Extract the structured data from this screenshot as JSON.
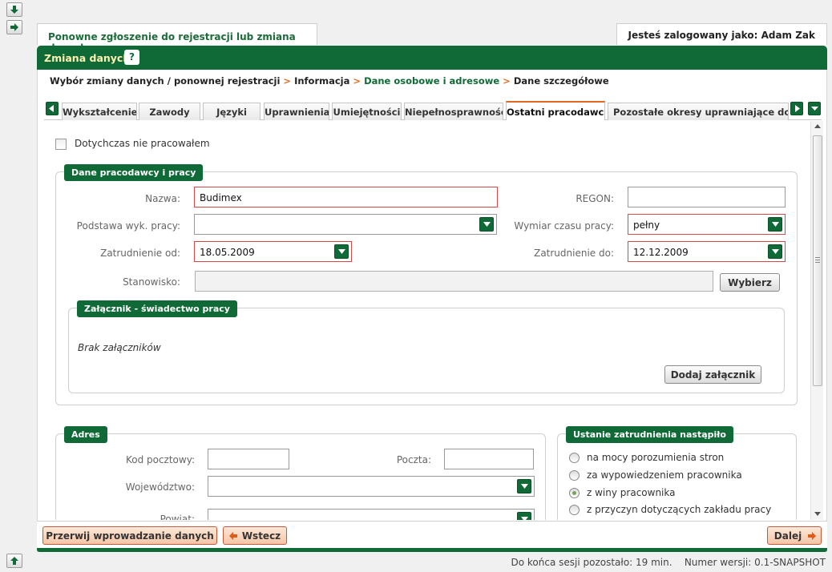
{
  "header": {
    "page_tab": "Ponowne zgłoszenie do rejestracji lub zmiana danych",
    "login_prefix": "Jesteś zalogowany jako:",
    "user_name": "Adam Zak"
  },
  "main": {
    "title": "Zmiana danych",
    "help_label": "?"
  },
  "breadcrumb": {
    "items": [
      "Wybór zmiany danych / ponownej rejestracji",
      "Informacja",
      "Dane osobowe i adresowe",
      "Dane szczegółowe"
    ],
    "separator": ">"
  },
  "tabs": [
    {
      "label": "Wykształcenie",
      "active": false
    },
    {
      "label": "Zawody",
      "active": false
    },
    {
      "label": "Języki",
      "active": false
    },
    {
      "label": "Uprawnienia",
      "active": false
    },
    {
      "label": "Umiejętności",
      "active": false
    },
    {
      "label": "Niepełnosprawność",
      "active": false
    },
    {
      "label": "Ostatni pracodawca",
      "active": true
    },
    {
      "label": "Pozostałe okresy uprawniające do zasiłku",
      "active": false
    }
  ],
  "form": {
    "never_worked_label": "Dotychczas nie pracowałem",
    "never_worked_checked": false,
    "employer_section": "Dane pracodawcy i pracy",
    "fields": {
      "name_label": "Nazwa:",
      "name_value": "Budimex",
      "regon_label": "REGON:",
      "regon_value": "",
      "basis_label": "Podstawa wyk. pracy:",
      "basis_value": "",
      "worktime_label": "Wymiar czasu pracy:",
      "worktime_value": "pełny",
      "from_label": "Zatrudnienie od:",
      "from_value": "18.05.2009",
      "to_label": "Zatrudnienie do:",
      "to_value": "12.12.2009",
      "position_label": "Stanowisko:",
      "position_value": ""
    },
    "choose_button": "Wybierz",
    "attachment_section": "Załącznik - świadectwo pracy",
    "no_attachments": "Brak załączników",
    "add_attachment_button": "Dodaj załącznik",
    "address": {
      "section": "Adres",
      "postal_code_label": "Kod pocztowy:",
      "postal_code_value": "",
      "post_label": "Poczta:",
      "post_value": "",
      "voivodeship_label": "Województwo:",
      "voivodeship_value": "",
      "district_label": "Powiat:",
      "district_value": ""
    },
    "termination": {
      "section": "Ustanie zatrudnienia nastąpiło",
      "options": [
        {
          "label": "na mocy porozumienia stron",
          "selected": false
        },
        {
          "label": "za wypowiedzeniem pracownika",
          "selected": false
        },
        {
          "label": "z winy pracownika",
          "selected": true
        },
        {
          "label": "z przyczyn dotyczących zakładu pracy",
          "selected": false
        }
      ]
    }
  },
  "footer": {
    "abort_button": "Przerwij wprowadzanie danych",
    "back_button": "Wstecz",
    "next_button": "Dalej"
  },
  "status": {
    "session_text": "Do końca sesji pozostało: 19 min.",
    "version_text": "Numer wersji: 0.1-SNAPSHOT"
  },
  "colors": {
    "brand_green": "#0f6a37",
    "accent_orange": "#e06a22",
    "required_red": "#d24b4b"
  }
}
